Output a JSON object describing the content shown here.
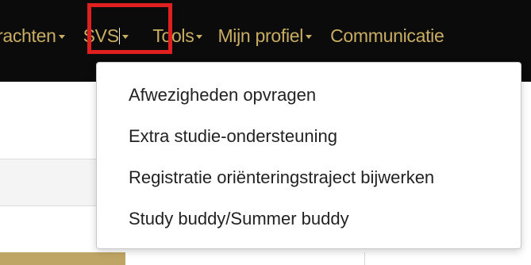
{
  "navbar": {
    "items": [
      {
        "label": "rachten"
      },
      {
        "label": "SVS"
      },
      {
        "label": "Tools"
      },
      {
        "label": "Mijn profiel"
      },
      {
        "label": "Communicatie"
      }
    ]
  },
  "dropdown": {
    "items": [
      {
        "label": "Afwezigheden opvragen"
      },
      {
        "label": "Extra studie-ondersteuning"
      },
      {
        "label": "Registratie oriënteringstraject bijwerken"
      },
      {
        "label": "Study buddy/Summer buddy"
      }
    ]
  },
  "colors": {
    "navbar_bg": "#0b0b0b",
    "nav_text": "#c9ad63",
    "highlight": "#e0201f",
    "accent_gold": "#bfa565"
  }
}
